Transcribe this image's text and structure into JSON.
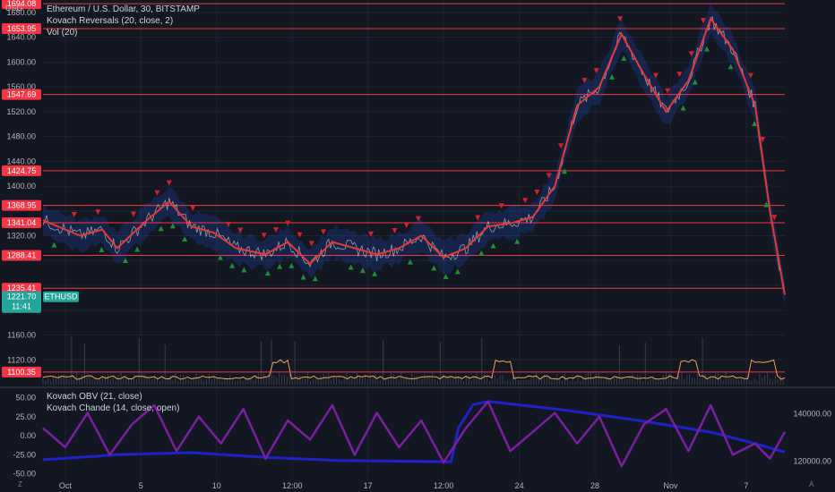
{
  "chart_data": [
    {
      "type": "line",
      "title": "Ethereum / U.S. Dollar, 30, BITSTAMP",
      "indicators": [
        "Kovach Reversals (20, close, 2)",
        "Vol (20)"
      ],
      "axis_unit": "USD",
      "ylim": [
        1080,
        1700
      ],
      "yticks": [
        1120,
        1160,
        1200,
        1240,
        1280,
        1320,
        1360,
        1400,
        1440,
        1480,
        1520,
        1560,
        1600,
        1640,
        1680
      ],
      "xticks": [
        "Oct",
        "5",
        "10",
        "12:00",
        "17",
        "12:00",
        "24",
        "28",
        "Nov",
        "7"
      ],
      "grid": true,
      "price_series": {
        "name": "ETHUSD",
        "x": [
          0,
          3,
          5,
          8,
          10,
          14,
          17,
          20,
          23,
          26,
          30,
          33,
          36,
          39,
          42,
          45,
          48,
          51,
          54,
          57,
          60,
          63,
          66,
          69,
          72,
          75,
          78,
          81,
          84,
          87,
          90,
          93,
          96,
          98,
          100
        ],
        "y": [
          1345,
          1330,
          1320,
          1330,
          1300,
          1345,
          1375,
          1335,
          1325,
          1300,
          1290,
          1310,
          1275,
          1310,
          1300,
          1290,
          1300,
          1320,
          1285,
          1300,
          1335,
          1340,
          1350,
          1400,
          1530,
          1560,
          1645,
          1580,
          1520,
          1570,
          1670,
          1620,
          1530,
          1360,
          1225
        ]
      },
      "horizontal_levels": [
        1100.35,
        1235.41,
        1288.41,
        1341.04,
        1368.95,
        1424.75,
        1547.69,
        1653.95,
        1694.08
      ],
      "current_price": {
        "label": "ETHUSD",
        "value": "1221.70",
        "countdown": "11:41"
      }
    },
    {
      "type": "line",
      "title": "",
      "indicators": [
        "Kovach OBV (21, close)",
        "Kovach Chande (14, close, open)"
      ],
      "left_axis": {
        "ylim": [
          -55,
          60
        ],
        "ticks": [
          "50.00",
          "25.00",
          "0.00",
          "-25.00",
          "-50.00"
        ]
      },
      "right_axis": {
        "ylim": [
          113000,
          150000
        ],
        "ticks": [
          "140000.00",
          "120000.00"
        ]
      },
      "series": [
        {
          "name": "Kovach OBV (21, close)",
          "color": "#1e22c8",
          "axis": "right",
          "x": [
            0,
            5,
            10,
            20,
            30,
            40,
            50,
            55,
            56,
            58,
            60,
            70,
            80,
            90,
            95,
            100
          ],
          "y": [
            120500,
            122000,
            122500,
            123500,
            121500,
            120500,
            119500,
            119500,
            134000,
            144000,
            145500,
            141500,
            137500,
            132500,
            128500,
            124000
          ]
        },
        {
          "name": "Kovach Chande (14, close, open)",
          "color": "#7b1fa2",
          "axis": "left",
          "x": [
            0,
            3,
            6,
            9,
            12,
            15,
            18,
            21,
            24,
            27,
            30,
            33,
            36,
            39,
            42,
            45,
            48,
            51,
            54,
            57,
            60,
            63,
            66,
            69,
            72,
            75,
            78,
            81,
            84,
            87,
            90,
            93,
            96,
            98,
            100
          ],
          "y": [
            10,
            -15,
            30,
            -25,
            15,
            40,
            -20,
            25,
            -10,
            35,
            -30,
            20,
            -5,
            40,
            -25,
            30,
            -15,
            20,
            -35,
            10,
            45,
            -20,
            5,
            30,
            -10,
            25,
            -40,
            15,
            35,
            -20,
            40,
            -25,
            -10,
            -30,
            5
          ]
        }
      ]
    }
  ],
  "price_axis_labels": [
    "1694.08",
    "1680.00",
    "1653.95",
    "1640.00",
    "1600.00",
    "1560.00",
    "1547.69",
    "1520.00",
    "1480.00",
    "1440.00",
    "1424.75",
    "1400.00",
    "1368.95",
    "1341.04",
    "1320.00",
    "1288.41",
    "1235.41",
    "1221.70",
    "1160.00",
    "1120.00",
    "1100.35"
  ],
  "colors": {
    "background": "#131722",
    "level": "#f23645",
    "tag": "#f23645",
    "current": "#26a69a",
    "price_line": "#e53935",
    "obv": "#1e22c8",
    "chande": "#7b1fa2",
    "up_arrow": "#1b8f3a",
    "down_arrow": "#d3212d",
    "band": "#2962ff"
  },
  "corner_labels": {
    "bottom_left": "Z",
    "bottom_right": "A"
  }
}
